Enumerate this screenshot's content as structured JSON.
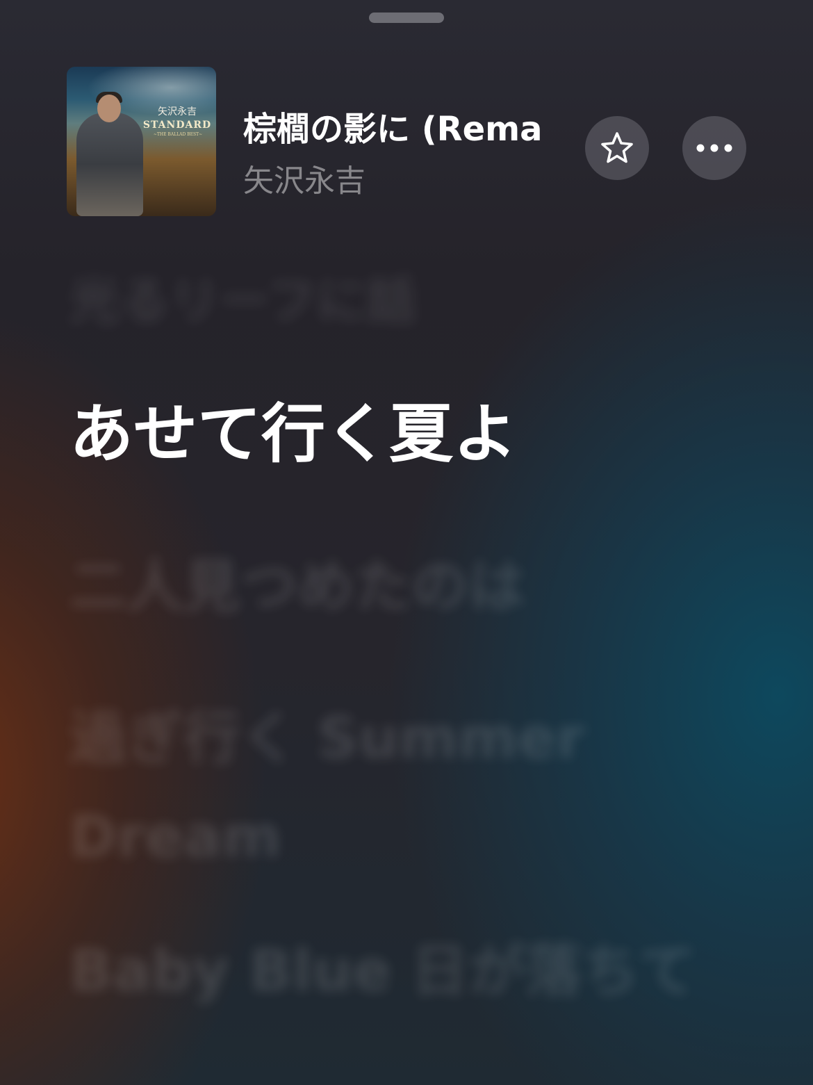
{
  "header": {
    "grabber": "sheet-grabber"
  },
  "album_art": {
    "artist_text": "矢沢永吉",
    "title_text": "STANDARD",
    "subtitle_text": "~THE BALLAD BEST~"
  },
  "track": {
    "title": "棕櫚の影に (Rema",
    "artist": "矢沢永吉"
  },
  "buttons": {
    "favorite_icon": "star-icon",
    "more_icon": "ellipsis-icon"
  },
  "lyrics": {
    "previous": "光るリーフに話",
    "current": "あせて行く夏よ",
    "next": [
      "二人見つめたのは",
      "過ぎ行く Summer Dream",
      "Baby Blue 日が落ちて"
    ]
  },
  "colors": {
    "background": "#25232a",
    "accent_warm": "#6e3014",
    "accent_cool": "#0c4a60",
    "button_bg": "#78787f"
  }
}
